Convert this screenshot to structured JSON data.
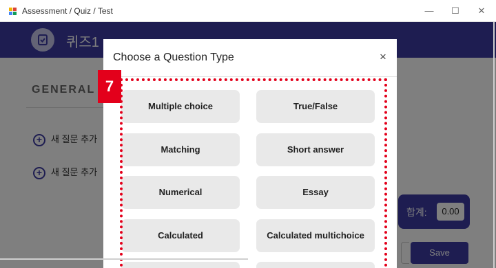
{
  "window": {
    "title": "Assessment / Quiz / Test",
    "minimize_icon": "—",
    "maximize_icon": "☐",
    "close_icon": "✕"
  },
  "header": {
    "quiz_title": "퀴즈1"
  },
  "main": {
    "section_title": "GENERAL",
    "add_question_label": "새 질문 추가",
    "total_label": "합계:",
    "total_value": "0.00",
    "save_label": "Save"
  },
  "modal": {
    "title": "Choose a Question Type",
    "close_icon": "×",
    "question_types": [
      "Multiple choice",
      "True/False",
      "Matching",
      "Short answer",
      "Numerical",
      "Essay",
      "Calculated",
      "Calculated multichoice"
    ]
  },
  "annotation": {
    "marker_number": "7",
    "color": "#e3001b"
  },
  "colors": {
    "brand": "#3d3ba3",
    "button_gray": "#e9e9e9"
  }
}
